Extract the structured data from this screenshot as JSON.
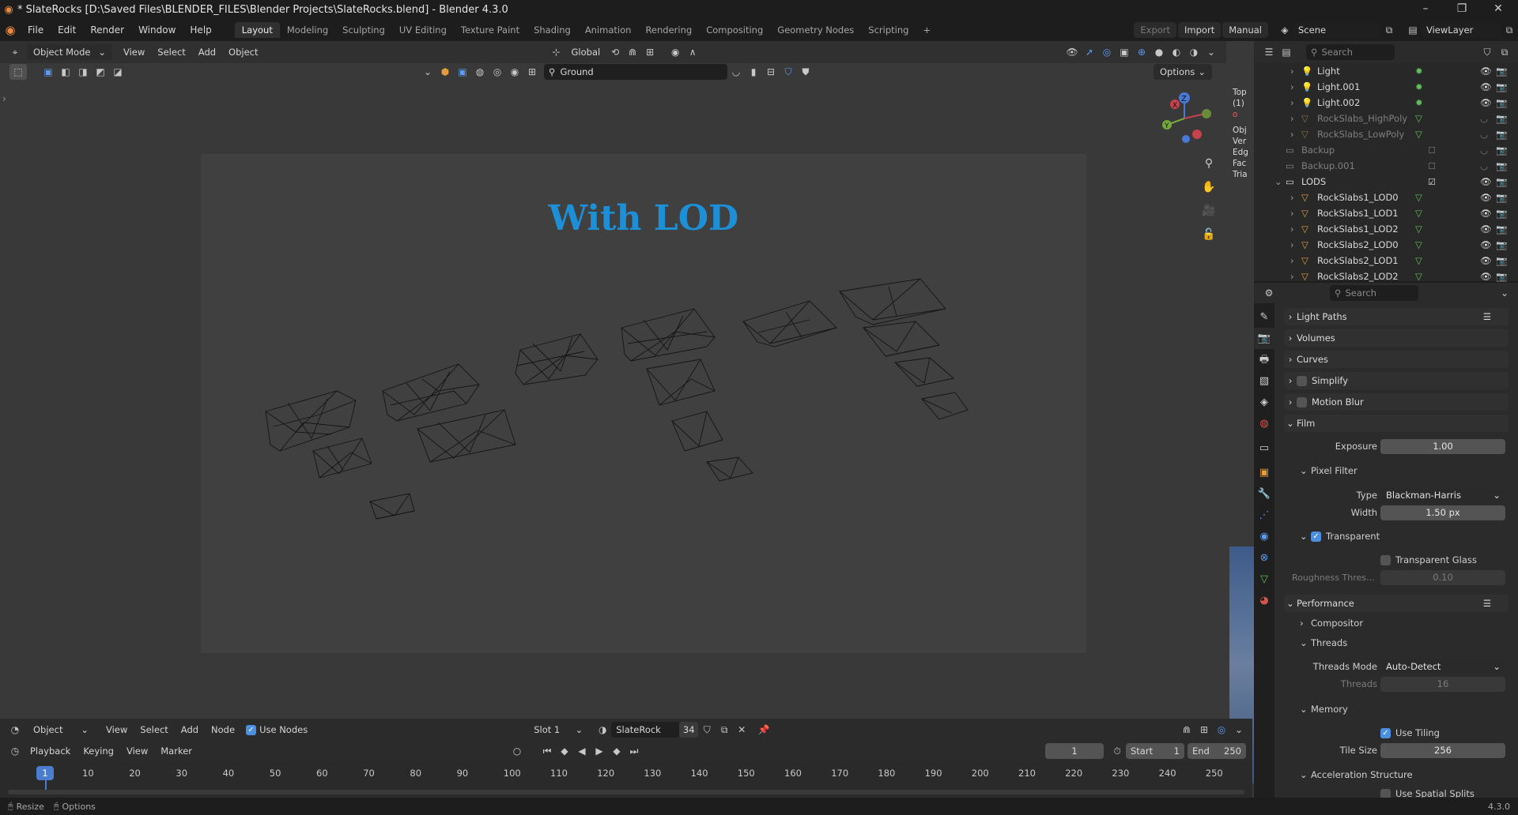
{
  "window": {
    "title": "* SlateRocks [D:\\Saved Files\\BLENDER_FILES\\Blender Projects\\SlateRocks.blend] - Blender 4.3.0",
    "minimize": "–",
    "maximize": "❐",
    "close": "✕"
  },
  "menu": {
    "items": [
      "File",
      "Edit",
      "Render",
      "Window",
      "Help"
    ],
    "workspaces": [
      "Layout",
      "Modeling",
      "Sculpting",
      "UV Editing",
      "Texture Paint",
      "Shading",
      "Animation",
      "Rendering",
      "Compositing",
      "Geometry Nodes",
      "Scripting"
    ],
    "add_ws": "+",
    "export": "Export",
    "import": "Import",
    "manual": "Manual",
    "scene": "Scene",
    "view_layer": "ViewLayer"
  },
  "viewport_header": {
    "mode": "Object Mode",
    "items": [
      "View",
      "Select",
      "Add",
      "Object"
    ],
    "orientation": "Global",
    "search_value": "Ground",
    "options": "Options"
  },
  "viewport": {
    "overlay_text": "With LOD",
    "accent": "#1c8fd6"
  },
  "outliner": {
    "search_placeholder": "Search",
    "rows": [
      {
        "name": "Light",
        "icon": "light-icon",
        "dim": false
      },
      {
        "name": "Light.001",
        "icon": "light-icon",
        "dim": false
      },
      {
        "name": "Light.002",
        "icon": "light-icon",
        "dim": false
      },
      {
        "name": "RockSlabs_HighPoly",
        "icon": "mesh-icon",
        "dim": true
      },
      {
        "name": "RockSlabs_LowPoly",
        "icon": "mesh-icon",
        "dim": true
      },
      {
        "name": "Backup",
        "icon": "collection-icon",
        "dim": true
      },
      {
        "name": "Backup.001",
        "icon": "collection-icon",
        "dim": true
      },
      {
        "name": "LODS",
        "icon": "collection-icon",
        "dim": false
      },
      {
        "name": "RockSlabs1_LOD0",
        "icon": "mesh-icon",
        "dim": false
      },
      {
        "name": "RockSlabs1_LOD1",
        "icon": "mesh-icon",
        "dim": false
      },
      {
        "name": "RockSlabs1_LOD2",
        "icon": "mesh-icon",
        "dim": false
      },
      {
        "name": "RockSlabs2_LOD0",
        "icon": "mesh-icon",
        "dim": false
      },
      {
        "name": "RockSlabs2_LOD1",
        "icon": "mesh-icon",
        "dim": false
      },
      {
        "name": "RockSlabs2_LOD2",
        "icon": "mesh-icon",
        "dim": false
      }
    ]
  },
  "side_overlay": [
    "Top",
    "(1)",
    "o",
    "Obj",
    "Ver",
    "Edg",
    "Fac",
    "Tria"
  ],
  "properties": {
    "search_placeholder": "Search",
    "light_paths": "Light Paths",
    "volumes": "Volumes",
    "curves": "Curves",
    "simplify": "Simplify",
    "motion_blur": "Motion Blur",
    "film": "Film",
    "exposure_label": "Exposure",
    "exposure_value": "1.00",
    "pixel_filter": "Pixel Filter",
    "type_label": "Type",
    "type_value": "Blackman-Harris",
    "width_label": "Width",
    "width_value": "1.50 px",
    "transparent": "Transparent",
    "transparent_glass": "Transparent Glass",
    "roughness_label": "Roughness Thres...",
    "roughness_value": "0.10",
    "performance": "Performance",
    "compositor": "Compositor",
    "threads": "Threads",
    "threads_mode_label": "Threads Mode",
    "threads_mode_value": "Auto-Detect",
    "threads_label": "Threads",
    "threads_value": "16",
    "memory": "Memory",
    "use_tiling": "Use Tiling",
    "tile_size_label": "Tile Size",
    "tile_size_value": "256",
    "accel": "Acceleration Structure",
    "accel_partial": "Use Spatial Splits"
  },
  "node_header": {
    "editor": "Object",
    "items": [
      "View",
      "Select",
      "Add",
      "Node"
    ],
    "use_nodes": "Use Nodes",
    "slot": "Slot 1",
    "material": "SlateRock",
    "users": "34"
  },
  "timeline": {
    "items": [
      "Playback",
      "Keying",
      "View",
      "Marker"
    ],
    "current_frame": "1",
    "start_label": "Start",
    "start": "1",
    "end_label": "End",
    "end": "250",
    "ticks": [
      "10",
      "20",
      "30",
      "40",
      "50",
      "60",
      "70",
      "80",
      "90",
      "100",
      "110",
      "120",
      "130",
      "140",
      "150",
      "160",
      "170",
      "180",
      "190",
      "200",
      "210",
      "220",
      "230",
      "240",
      "250"
    ],
    "playhead": "1"
  },
  "status": {
    "resize": "Resize",
    "options": "Options",
    "version": "4.3.0"
  }
}
